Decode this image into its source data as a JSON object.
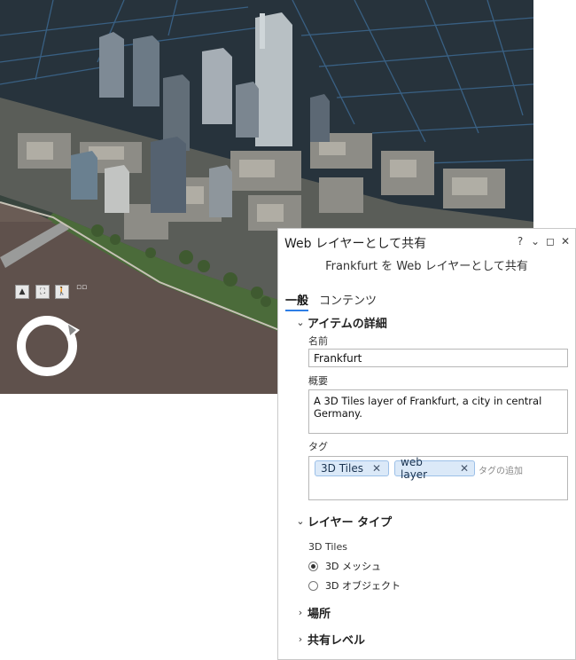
{
  "scene": {
    "navigation": {
      "up_icon": "▲",
      "full_extent_icon": "⛶",
      "walk_icon": "🚶",
      "mini_icon": "▫▫"
    }
  },
  "panel": {
    "title": "Web レイヤーとして共有",
    "controls": {
      "help": "?",
      "menu": "⌄",
      "maximize": "◻",
      "close": "✕"
    },
    "subtitle": "Frankfurt を Web レイヤーとして共有",
    "tabs": [
      {
        "label": "一般",
        "active": true
      },
      {
        "label": "コンテンツ",
        "active": false
      }
    ],
    "item_details": {
      "header": "アイテムの詳細",
      "name_label": "名前",
      "name_value": "Frankfurt",
      "summary_label": "概要",
      "summary_value": "A 3D Tiles layer of Frankfurt, a city in central Germany.",
      "tags_label": "タグ",
      "tags": [
        "3D Tiles",
        "web layer"
      ],
      "tag_placeholder": "タグの追加"
    },
    "layer_type": {
      "header": "レイヤー タイプ",
      "group_label": "3D Tiles",
      "options": [
        {
          "label": "3D メッシュ",
          "selected": true
        },
        {
          "label": "3D オブジェクト",
          "selected": false
        }
      ]
    },
    "location_header": "場所",
    "sharing_level_header": "共有レベル"
  }
}
